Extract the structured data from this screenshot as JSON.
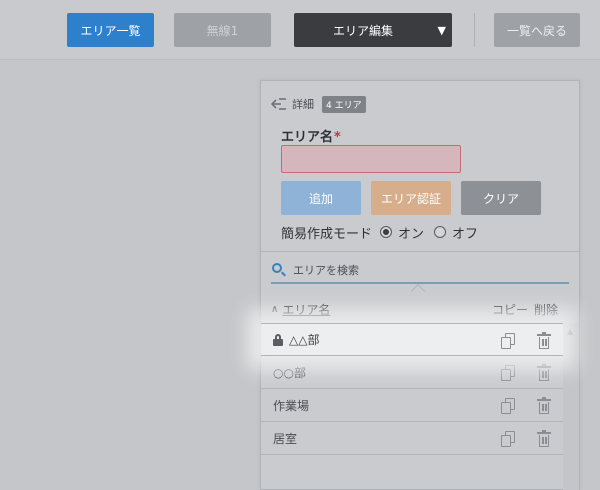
{
  "toolbar": {
    "area_list_label": "エリア一覧",
    "wireless_label": "無線1",
    "area_edit_label": "エリア編集",
    "area_edit_caret": "▼",
    "back_to_list_label": "一覧へ戻る"
  },
  "panel": {
    "detail_label": "詳細",
    "area_count_badge": "4 エリア",
    "back_icon": "indent-left-icon",
    "form": {
      "area_name_label": "エリア名",
      "required_mark": "*",
      "area_name_value": "",
      "area_name_placeholder": ""
    },
    "actions": {
      "add_label": "追加",
      "auth_label": "エリア認証",
      "clear_label": "クリア"
    },
    "mode": {
      "label": "簡易作成モード",
      "on_label": "オン",
      "off_label": "オフ",
      "selected": "オン"
    },
    "search": {
      "placeholder": "エリアを検索",
      "icon": "search-icon"
    },
    "table": {
      "sort_caret": "∧",
      "name_header": "エリア名",
      "copy_header": "コピー",
      "delete_header": "削除",
      "rows": [
        {
          "name": "△△部",
          "locked": true
        },
        {
          "name": "○○部",
          "locked": false
        },
        {
          "name": "作業場",
          "locked": false
        },
        {
          "name": "居室",
          "locked": false
        }
      ]
    },
    "scroll_up_glyph": "▲"
  },
  "colors": {
    "primary": "#2f80cc",
    "required": "#c0392b",
    "search_accent": "#3a7fc0",
    "add_button": "#8fb3d6",
    "auth_button": "#d6ae8c"
  }
}
